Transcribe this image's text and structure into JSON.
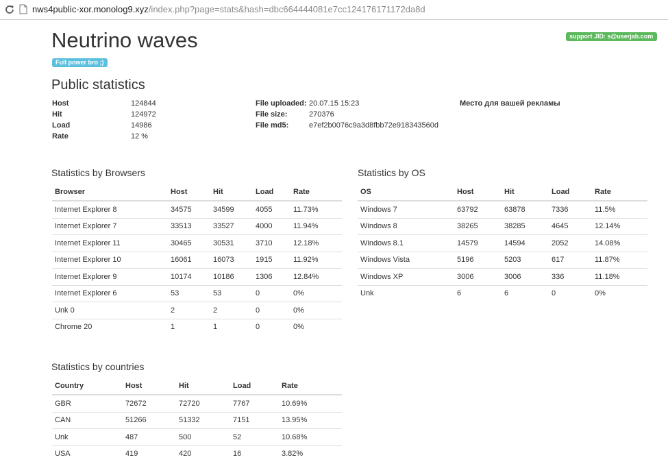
{
  "browser_bar": {
    "url_host": "nws4public-xor.monolog9.xyz",
    "url_path": "/index.php?page=stats&hash=dbc664444081e7cc124176171172da8d"
  },
  "header": {
    "title": "Neutrino waves",
    "badge": "Full power bro ;)",
    "support": "support JID: s@userjab.com"
  },
  "summary": {
    "heading": "Public statistics",
    "stats": [
      {
        "label": "Host",
        "value": "124844"
      },
      {
        "label": "Hit",
        "value": "124972"
      },
      {
        "label": "Load",
        "value": "14986"
      },
      {
        "label": "Rate",
        "value": "12 %"
      }
    ],
    "file": [
      {
        "label": "File uploaded:",
        "value": "20.07.15 15:23"
      },
      {
        "label": "File size:",
        "value": "270376"
      },
      {
        "label": "File md5:",
        "value": "e7ef2b0076c9a3d8fbb72e918343560d"
      }
    ],
    "ad_text": "Место для вашей рекламы"
  },
  "browsers": {
    "title": "Statistics by Browsers",
    "columns": [
      "Browser",
      "Host",
      "Hit",
      "Load",
      "Rate"
    ],
    "rows": [
      [
        "Internet Explorer 8",
        "34575",
        "34599",
        "4055",
        "11.73%"
      ],
      [
        "Internet Explorer 7",
        "33513",
        "33527",
        "4000",
        "11.94%"
      ],
      [
        "Internet Explorer 11",
        "30465",
        "30531",
        "3710",
        "12.18%"
      ],
      [
        "Internet Explorer 10",
        "16061",
        "16073",
        "1915",
        "11.92%"
      ],
      [
        "Internet Explorer 9",
        "10174",
        "10186",
        "1306",
        "12.84%"
      ],
      [
        "Internet Explorer 6",
        "53",
        "53",
        "0",
        "0%"
      ],
      [
        "Unk 0",
        "2",
        "2",
        "0",
        "0%"
      ],
      [
        "Chrome 20",
        "1",
        "1",
        "0",
        "0%"
      ]
    ]
  },
  "os": {
    "title": "Statistics by OS",
    "columns": [
      "OS",
      "Host",
      "Hit",
      "Load",
      "Rate"
    ],
    "rows": [
      [
        "Windows 7",
        "63792",
        "63878",
        "7336",
        "11.5%"
      ],
      [
        "Windows 8",
        "38265",
        "38285",
        "4645",
        "12.14%"
      ],
      [
        "Windows 8.1",
        "14579",
        "14594",
        "2052",
        "14.08%"
      ],
      [
        "Windows Vista",
        "5196",
        "5203",
        "617",
        "11.87%"
      ],
      [
        "Windows XP",
        "3006",
        "3006",
        "336",
        "11.18%"
      ],
      [
        "Unk",
        "6",
        "6",
        "0",
        "0%"
      ]
    ]
  },
  "countries": {
    "title": "Statistics by countries",
    "columns": [
      "Country",
      "Host",
      "Hit",
      "Load",
      "Rate"
    ],
    "rows": [
      [
        "GBR",
        "72672",
        "72720",
        "7767",
        "10.69%"
      ],
      [
        "CAN",
        "51266",
        "51332",
        "7151",
        "13.95%"
      ],
      [
        "Unk",
        "487",
        "500",
        "52",
        "10.68%"
      ],
      [
        "USA",
        "419",
        "420",
        "16",
        "3.82%"
      ]
    ]
  },
  "colors": {
    "badge_blue": "#5bc0de",
    "badge_green": "#5cb85c",
    "text": "#333333",
    "rule": "#dddddd"
  }
}
